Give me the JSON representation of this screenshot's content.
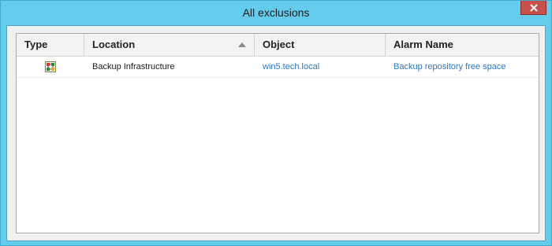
{
  "window": {
    "title": "All exclusions"
  },
  "icons": {
    "close": "close-icon",
    "sort": "sort-ascending-icon",
    "row_type": "backup-infrastructure-icon"
  },
  "colors": {
    "titlebar": "#65cbeb",
    "close_button": "#c7504a",
    "link": "#2e74c0"
  },
  "grid": {
    "columns": [
      {
        "label": "Type"
      },
      {
        "label": "Location",
        "sorted": "ascending"
      },
      {
        "label": "Object"
      },
      {
        "label": "Alarm Name"
      }
    ],
    "rows": [
      {
        "type_icon": "backup-infrastructure-icon",
        "location": "Backup Infrastructure",
        "object": "win5.tech.local",
        "alarm_name": "Backup repository free space"
      }
    ]
  }
}
